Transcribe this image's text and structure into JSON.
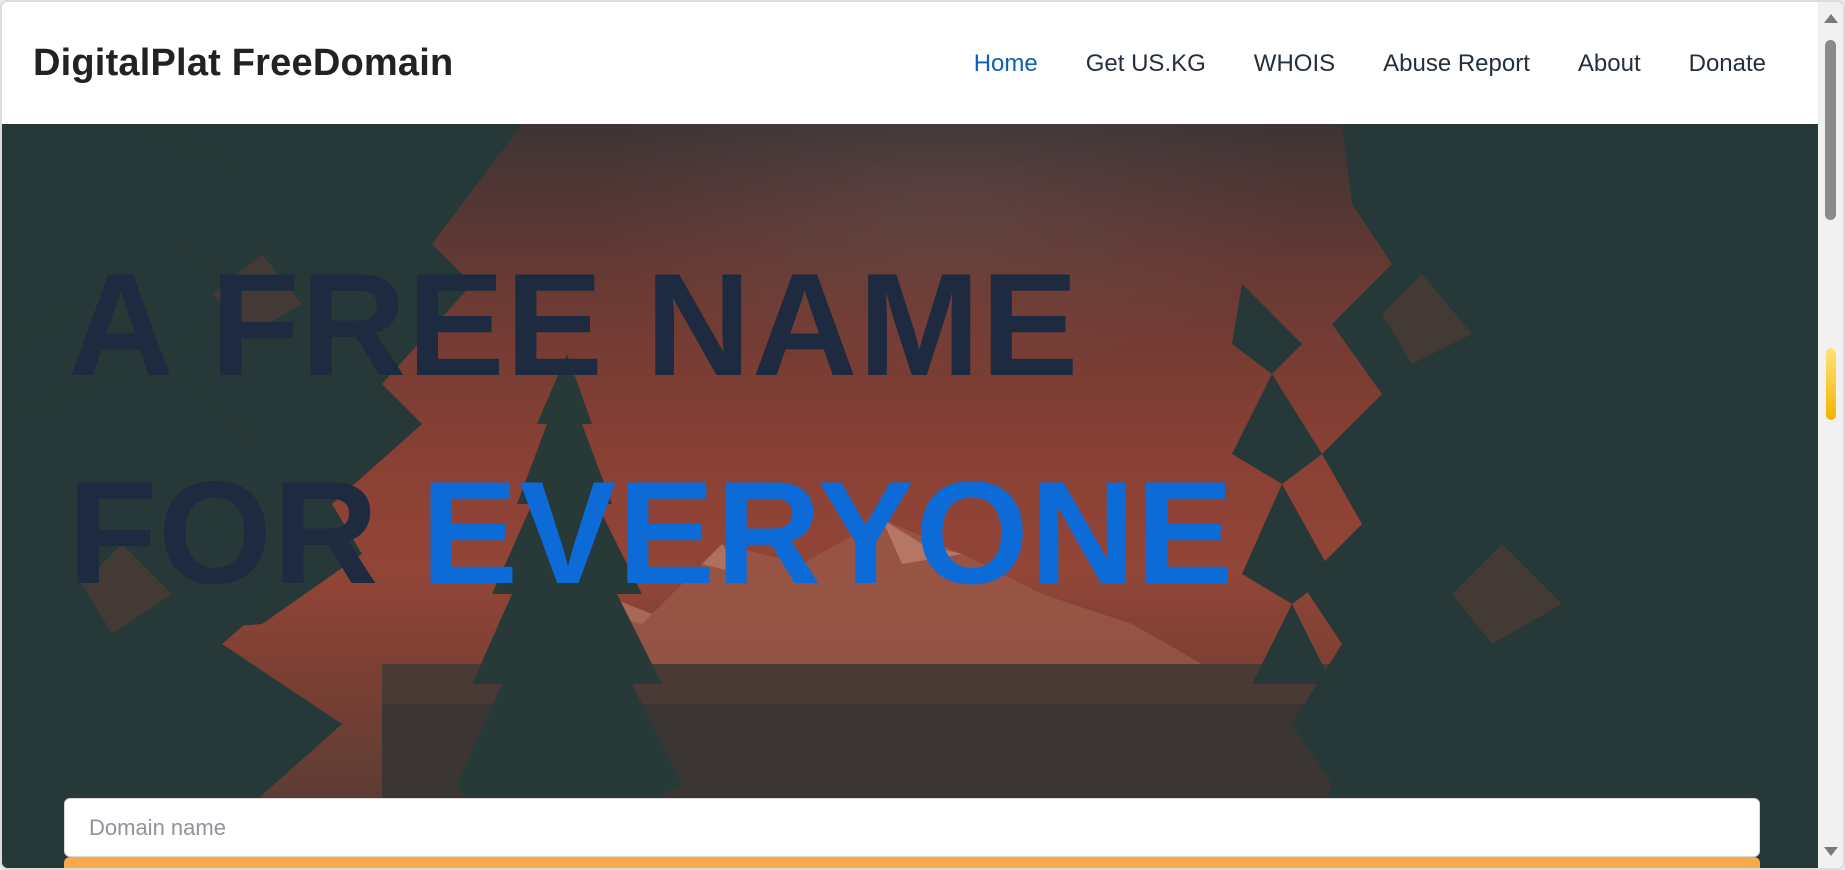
{
  "header": {
    "brand": "DigitalPlat FreeDomain",
    "nav": [
      {
        "label": "Home",
        "active": true
      },
      {
        "label": "Get US.KG",
        "active": false
      },
      {
        "label": "WHOIS",
        "active": false
      },
      {
        "label": "Abuse Report",
        "active": false
      },
      {
        "label": "About",
        "active": false
      },
      {
        "label": "Donate",
        "active": false
      }
    ]
  },
  "hero": {
    "line1": "A FREE NAME",
    "line2_prefix": "FOR ",
    "line2_accent": "EVERYONE",
    "accent_color": "#0d6bd8",
    "headline_color": "#1d2a40"
  },
  "search": {
    "placeholder": "Domain name",
    "value": ""
  },
  "colors": {
    "nav_active": "#0f60b0",
    "submit": "#f9a94a"
  }
}
